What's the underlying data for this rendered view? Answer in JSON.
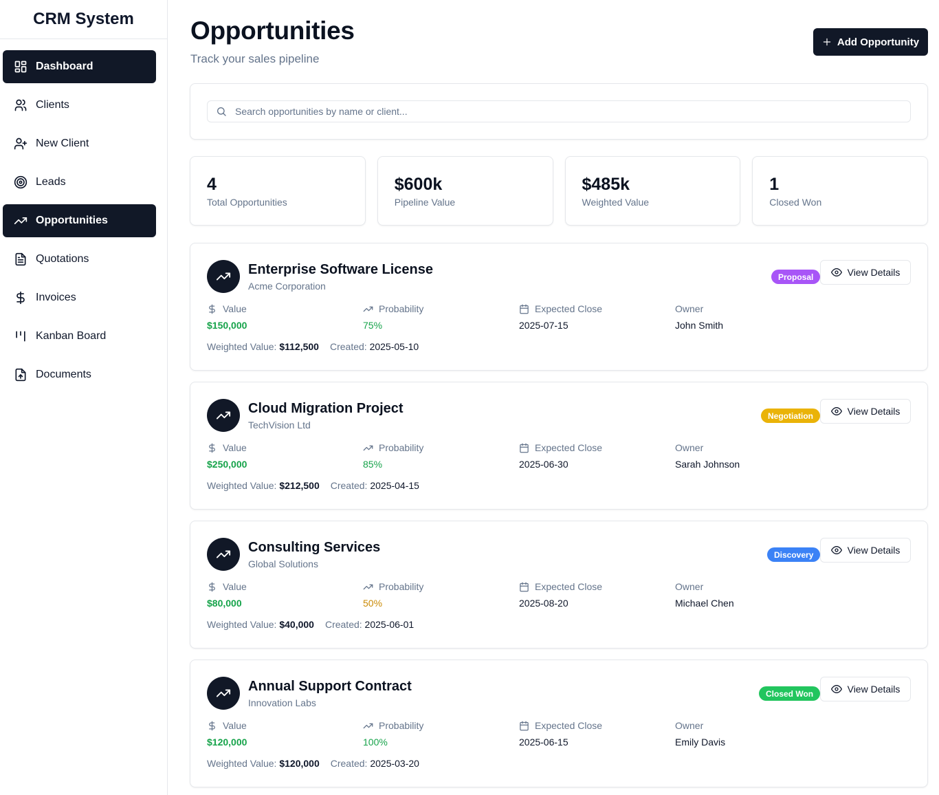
{
  "app": {
    "title": "CRM System"
  },
  "sidebar": {
    "items": [
      {
        "label": "Dashboard",
        "icon": "dashboard-icon",
        "active": true
      },
      {
        "label": "Clients",
        "icon": "users-icon",
        "active": false
      },
      {
        "label": "New Client",
        "icon": "user-plus-icon",
        "active": false
      },
      {
        "label": "Leads",
        "icon": "target-icon",
        "active": false
      },
      {
        "label": "Opportunities",
        "icon": "trending-up-icon",
        "active": true
      },
      {
        "label": "Quotations",
        "icon": "file-text-icon",
        "active": false
      },
      {
        "label": "Invoices",
        "icon": "dollar-icon",
        "active": false
      },
      {
        "label": "Kanban Board",
        "icon": "kanban-icon",
        "active": false
      },
      {
        "label": "Documents",
        "icon": "file-upload-icon",
        "active": false
      }
    ]
  },
  "header": {
    "title": "Opportunities",
    "subtitle": "Track your sales pipeline",
    "add_button": "Add Opportunity"
  },
  "search": {
    "placeholder": "Search opportunities by name or client..."
  },
  "stats": [
    {
      "value": "4",
      "label": "Total Opportunities"
    },
    {
      "value": "$600k",
      "label": "Pipeline Value"
    },
    {
      "value": "$485k",
      "label": "Weighted Value"
    },
    {
      "value": "1",
      "label": "Closed Won"
    }
  ],
  "labels": {
    "value": "Value",
    "probability": "Probability",
    "expected_close": "Expected Close",
    "owner": "Owner",
    "weighted_value": "Weighted Value:",
    "created": "Created:",
    "view_details": "View Details"
  },
  "opportunities": [
    {
      "name": "Enterprise Software License",
      "client": "Acme Corporation",
      "stage": "Proposal",
      "stage_color": "#a855f7",
      "value": "$150,000",
      "probability": "75%",
      "probability_color": "#16a34a",
      "expected_close": "2025-07-15",
      "owner": "John Smith",
      "weighted_value": "$112,500",
      "created": "2025-05-10"
    },
    {
      "name": "Cloud Migration Project",
      "client": "TechVision Ltd",
      "stage": "Negotiation",
      "stage_color": "#eab308",
      "value": "$250,000",
      "probability": "85%",
      "probability_color": "#16a34a",
      "expected_close": "2025-06-30",
      "owner": "Sarah Johnson",
      "weighted_value": "$212,500",
      "created": "2025-04-15"
    },
    {
      "name": "Consulting Services",
      "client": "Global Solutions",
      "stage": "Discovery",
      "stage_color": "#3b82f6",
      "value": "$80,000",
      "probability": "50%",
      "probability_color": "#ca8a04",
      "expected_close": "2025-08-20",
      "owner": "Michael Chen",
      "weighted_value": "$40,000",
      "created": "2025-06-01"
    },
    {
      "name": "Annual Support Contract",
      "client": "Innovation Labs",
      "stage": "Closed Won",
      "stage_color": "#22c55e",
      "value": "$120,000",
      "probability": "100%",
      "probability_color": "#16a34a",
      "expected_close": "2025-06-15",
      "owner": "Emily Davis",
      "weighted_value": "$120,000",
      "created": "2025-03-20"
    }
  ]
}
